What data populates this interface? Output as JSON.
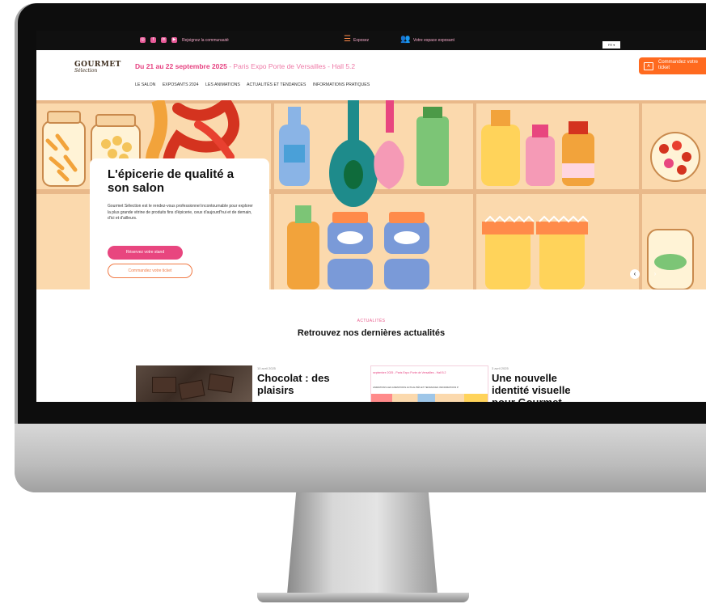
{
  "topbar": {
    "community_label": "Rejoignez la communauté",
    "exhibit_label": "Exposez",
    "exhibitor_space_label": "Votre espace exposant",
    "language": "FR ▾"
  },
  "header": {
    "logo_main": "GOURMET",
    "logo_sub": "Sélection",
    "dates_bold": "Du 21 au 22 septembre 2025",
    "dates_rest": " - Paris Expo Porte de Versailles - Hall 5.2",
    "nav": [
      "LE SALON",
      "EXPOSANTS 2024",
      "LES ANIMATIONS",
      "ACTUALITÉS ET TENDANCES",
      "INFORMATIONS PRATIQUES"
    ],
    "ticket_label": "Commandez votre ticket"
  },
  "hero": {
    "title": "L'épicerie de qualité a son salon",
    "description": "Gourmet Sélection est le rendez-vous professionnel incontournable pour explorer la plus grande vitrine de produits fins d'épicerie, ceux d'aujourd'hui et de demain, d'ici et d'ailleurs.",
    "primary_button": "Réservez votre stand",
    "secondary_button": "Commandez votre ticket",
    "prev_arrow": "‹",
    "next_arrow": "›"
  },
  "news": {
    "kicker": "ACTUALITÉS",
    "title": "Retrouvez nos dernières actualités",
    "items": [
      {
        "date": "10 avril 2025",
        "headline": "Chocolat : des plaisirs"
      },
      {
        "date": "3 avril 2025",
        "headline": "Une nouvelle identité visuelle pour Gourmet"
      }
    ],
    "thumb2_bar": "septembre 2025 - Paris Expo Porte de Versailles - Hall 5.2",
    "thumb2_nav": "ANIMATIONS   LES ANIMATIONS   ACTUALITÉS ET TENDANCES   INFORMATIONS P"
  },
  "colors": {
    "brand_pink": "#e63f7f",
    "accent_orange": "#ff6a1f",
    "hero_background": "#fbd9ad"
  }
}
